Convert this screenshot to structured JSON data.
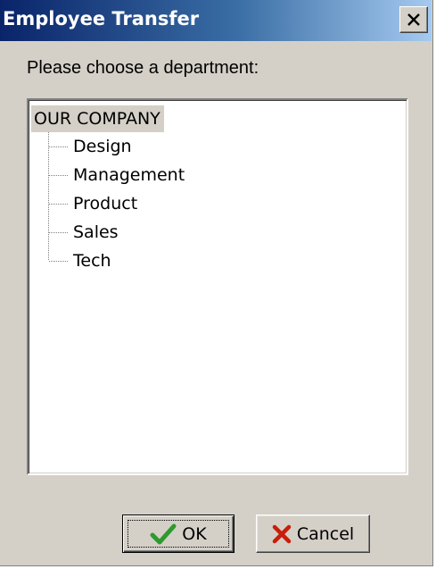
{
  "window": {
    "title": "Employee Transfer"
  },
  "prompt": "Please choose a department:",
  "tree": {
    "root": "OUR COMPANY",
    "items": [
      {
        "label": "Design"
      },
      {
        "label": "Management"
      },
      {
        "label": "Product"
      },
      {
        "label": "Sales"
      },
      {
        "label": "Tech"
      }
    ]
  },
  "buttons": {
    "ok_label": "OK",
    "cancel_label": "Cancel"
  },
  "icons": {
    "close": "close-icon",
    "ok": "checkmark-icon",
    "cancel": "x-mark-icon"
  },
  "colors": {
    "title_bar_start": "#0a246a",
    "title_bar_end": "#a6caf0",
    "dialog_face": "#d4d0c8",
    "checkmark": "#2e9a2e",
    "cancel_x": "#c81e0a"
  }
}
